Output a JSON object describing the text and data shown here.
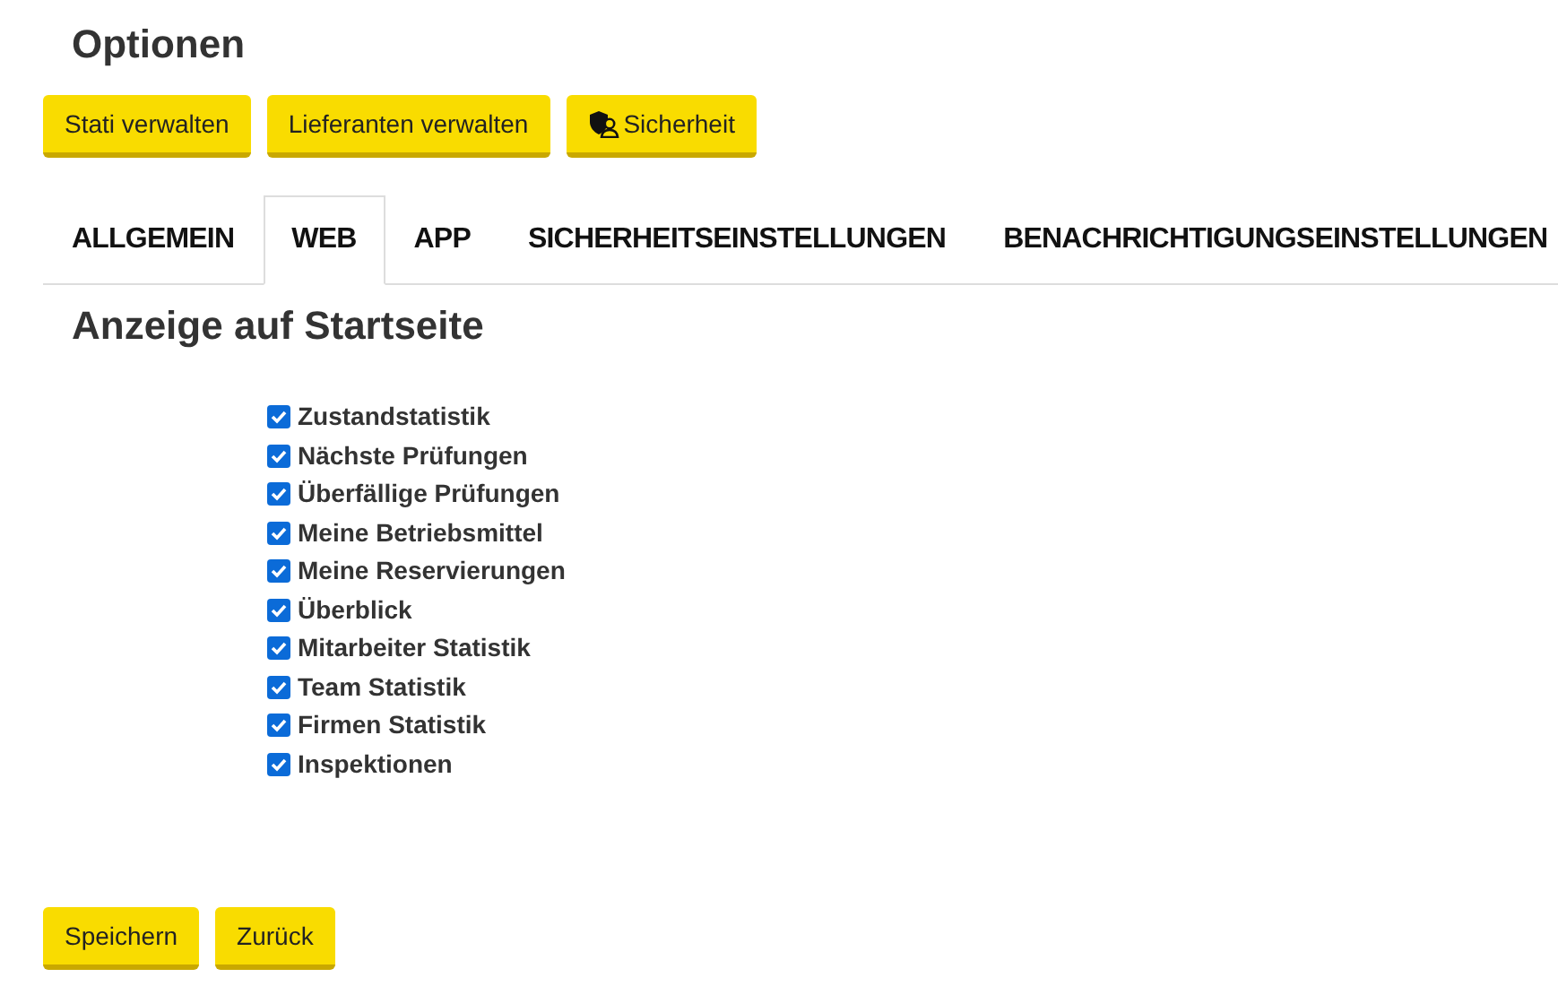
{
  "title": "Optionen",
  "top_buttons": [
    {
      "label": "Stati verwalten",
      "icon": false
    },
    {
      "label": "Lieferanten verwalten",
      "icon": false
    },
    {
      "label": "Sicherheit",
      "icon": true
    }
  ],
  "tabs": [
    {
      "label": "ALLGEMEIN",
      "selected": false
    },
    {
      "label": "WEB",
      "selected": true
    },
    {
      "label": "APP",
      "selected": false
    },
    {
      "label": "SICHERHEITSEINSTELLUNGEN",
      "selected": false
    },
    {
      "label": "BENACHRICHTIGUNGSEINSTELLUNGEN",
      "selected": false
    }
  ],
  "section_title": "Anzeige auf Startseite",
  "options": [
    {
      "label": "Zustandstatistik",
      "checked": true
    },
    {
      "label": "Nächste Prüfungen",
      "checked": true
    },
    {
      "label": "Überfällige Prüfungen",
      "checked": true
    },
    {
      "label": "Meine Betriebsmittel",
      "checked": true
    },
    {
      "label": "Meine Reservierungen",
      "checked": true
    },
    {
      "label": "Überblick",
      "checked": true
    },
    {
      "label": "Mitarbeiter Statistik",
      "checked": true
    },
    {
      "label": "Team Statistik",
      "checked": true
    },
    {
      "label": "Firmen Statistik",
      "checked": true
    },
    {
      "label": "Inspektionen",
      "checked": true
    }
  ],
  "bottom_buttons": [
    "Speichern",
    "Zurück"
  ]
}
